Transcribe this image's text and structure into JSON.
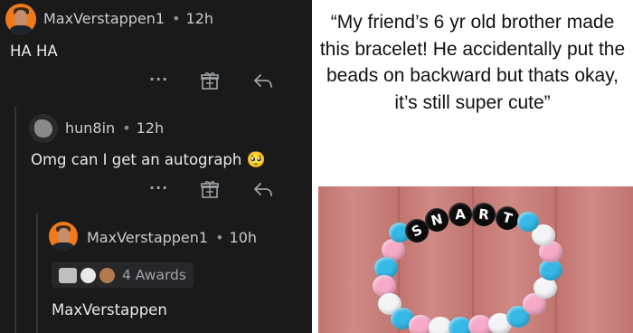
{
  "thread": {
    "comment1": {
      "username": "MaxVerstappen1",
      "age": "12h",
      "text": "HA HA"
    },
    "comment2": {
      "username": "hun8in",
      "age": "12h",
      "text": "Omg can I get an autograph",
      "emoji": "🥺"
    },
    "comment3": {
      "username": "MaxVerstappen1",
      "age": "10h",
      "awards_label": "4 Awards",
      "text": "MaxVerstappen"
    },
    "more_glyph": "···",
    "separator": "•"
  },
  "quote": {
    "text": "“My friend’s 6 yr old brother made this bracelet! He accidentally put the beads on backward but thats okay, it’s still super cute”"
  },
  "photo": {
    "bead_letters": [
      "S",
      "N",
      "A",
      "R",
      "T"
    ]
  },
  "colors": {
    "dark_bg": "#1a1a1b",
    "bead_pink": "#f6a9c8",
    "bead_blue": "#35b8e6",
    "bead_white": "#f4f4f6",
    "wood": "#c97b77"
  }
}
